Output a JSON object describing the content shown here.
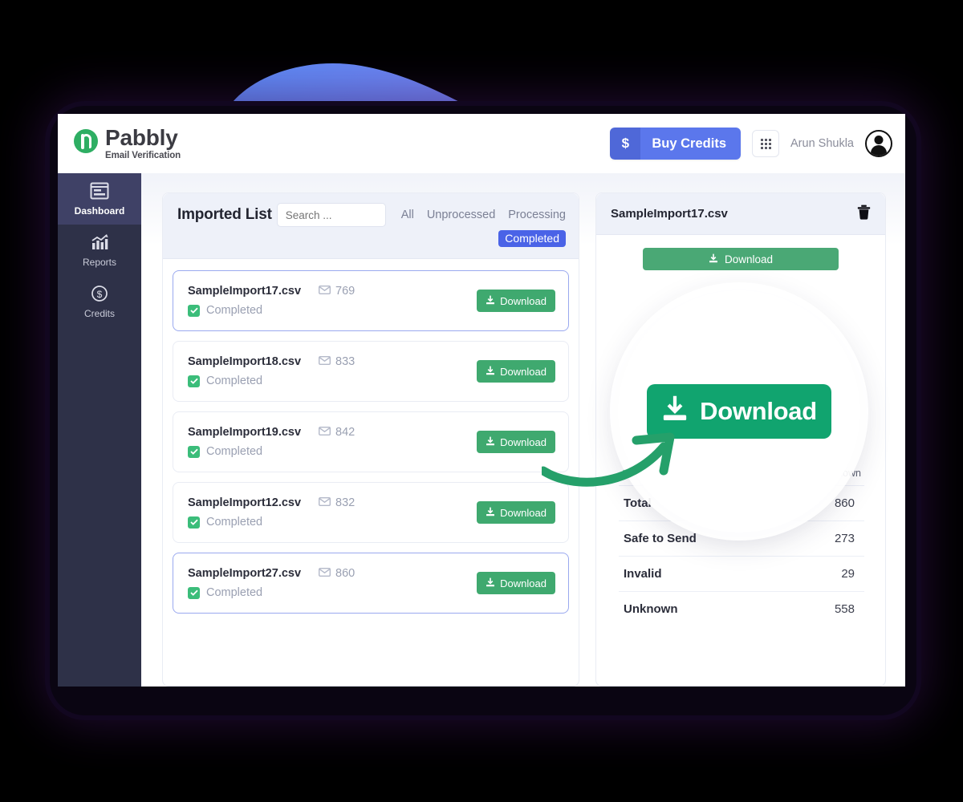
{
  "brand": {
    "name": "Pabbly",
    "tagline": "Email Verification",
    "logo_icon": "pabbly-p-logo-icon"
  },
  "topbar": {
    "buy_credits_label": "Buy Credits",
    "buy_credits_icon": "dollar-icon",
    "apps_grid_icon": "apps-grid-icon",
    "user_name": "Arun Shukla",
    "avatar_icon": "user-avatar-icon"
  },
  "sidebar": {
    "items": [
      {
        "label": "Dashboard",
        "icon": "dashboard-window-icon",
        "active": true
      },
      {
        "label": "Reports",
        "icon": "bar-chart-icon",
        "active": false
      },
      {
        "label": "Credits",
        "icon": "dollar-circle-icon",
        "active": false
      }
    ]
  },
  "imported_list": {
    "title": "Imported List",
    "search_placeholder": "Search ...",
    "search_value": "",
    "filters": [
      "All",
      "Unprocessed",
      "Processing"
    ],
    "active_filter": "Completed",
    "download_label": "Download",
    "items": [
      {
        "name": "SampleImport17.csv",
        "count": "769",
        "status": "Completed",
        "selected": true
      },
      {
        "name": "SampleImport18.csv",
        "count": "833",
        "status": "Completed",
        "selected": false
      },
      {
        "name": "SampleImport19.csv",
        "count": "842",
        "status": "Completed",
        "selected": false
      },
      {
        "name": "SampleImport12.csv",
        "count": "832",
        "status": "Completed",
        "selected": false
      },
      {
        "name": "SampleImport27.csv",
        "count": "860",
        "status": "Completed",
        "selected": true
      }
    ]
  },
  "detail": {
    "file_name": "SampleImport17.csv",
    "delete_icon": "trash-icon",
    "download_label": "Download",
    "legend": [
      {
        "label": "Safe to Send",
        "color": "#3bbd7a"
      },
      {
        "label": "Unknown",
        "color": "#c9ccd8"
      }
    ],
    "stats": [
      {
        "label": "Total",
        "value": "860"
      },
      {
        "label": "Safe to Send",
        "value": "273"
      },
      {
        "label": "Invalid",
        "value": "29"
      },
      {
        "label": "Unknown",
        "value": "558"
      }
    ]
  },
  "callout": {
    "magnified_label": "Download",
    "arrow_icon": "curved-arrow-icon"
  },
  "colors": {
    "accent_blue": "#5b77ec",
    "chip_blue": "#4a63e7",
    "green": "#3fa96f",
    "lens_green": "#11a46f",
    "sidebar": "#2e3148",
    "sidebar_active": "#3f4166"
  }
}
